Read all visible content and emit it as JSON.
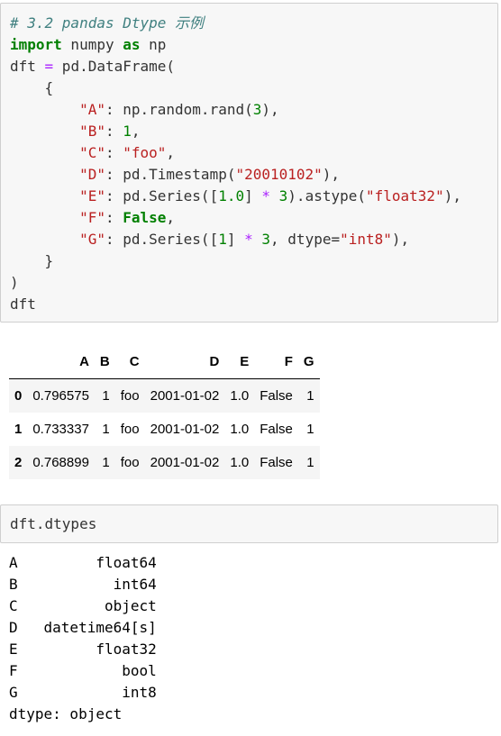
{
  "code_cell_1": {
    "lines": [
      [
        {
          "c": "cm",
          "t": "# 3.2 pandas Dtype 示例"
        }
      ],
      [
        {
          "c": "kw",
          "t": "import"
        },
        {
          "c": "pl",
          "t": " numpy "
        },
        {
          "c": "kw",
          "t": "as"
        },
        {
          "c": "pl",
          "t": " np"
        }
      ],
      [
        {
          "c": "pl",
          "t": "dft "
        },
        {
          "c": "op",
          "t": "="
        },
        {
          "c": "pl",
          "t": " pd.DataFrame("
        }
      ],
      [
        {
          "c": "pl",
          "t": "    {"
        }
      ],
      [
        {
          "c": "pl",
          "t": "        "
        },
        {
          "c": "st",
          "t": "\"A\""
        },
        {
          "c": "pl",
          "t": ": np.random.rand("
        },
        {
          "c": "nm",
          "t": "3"
        },
        {
          "c": "pl",
          "t": "),"
        }
      ],
      [
        {
          "c": "pl",
          "t": "        "
        },
        {
          "c": "st",
          "t": "\"B\""
        },
        {
          "c": "pl",
          "t": ": "
        },
        {
          "c": "nm",
          "t": "1"
        },
        {
          "c": "pl",
          "t": ","
        }
      ],
      [
        {
          "c": "pl",
          "t": "        "
        },
        {
          "c": "st",
          "t": "\"C\""
        },
        {
          "c": "pl",
          "t": ": "
        },
        {
          "c": "st",
          "t": "\"foo\""
        },
        {
          "c": "pl",
          "t": ","
        }
      ],
      [
        {
          "c": "pl",
          "t": "        "
        },
        {
          "c": "st",
          "t": "\"D\""
        },
        {
          "c": "pl",
          "t": ": pd.Timestamp("
        },
        {
          "c": "st",
          "t": "\"20010102\""
        },
        {
          "c": "pl",
          "t": "),"
        }
      ],
      [
        {
          "c": "pl",
          "t": "        "
        },
        {
          "c": "st",
          "t": "\"E\""
        },
        {
          "c": "pl",
          "t": ": pd.Series(["
        },
        {
          "c": "nm",
          "t": "1.0"
        },
        {
          "c": "pl",
          "t": "] "
        },
        {
          "c": "op",
          "t": "*"
        },
        {
          "c": "pl",
          "t": " "
        },
        {
          "c": "nm",
          "t": "3"
        },
        {
          "c": "pl",
          "t": ").astype("
        },
        {
          "c": "st",
          "t": "\"float32\""
        },
        {
          "c": "pl",
          "t": "),"
        }
      ],
      [
        {
          "c": "pl",
          "t": "        "
        },
        {
          "c": "st",
          "t": "\"F\""
        },
        {
          "c": "pl",
          "t": ": "
        },
        {
          "c": "kw",
          "t": "False"
        },
        {
          "c": "pl",
          "t": ","
        }
      ],
      [
        {
          "c": "pl",
          "t": "        "
        },
        {
          "c": "st",
          "t": "\"G\""
        },
        {
          "c": "pl",
          "t": ": pd.Series(["
        },
        {
          "c": "nm",
          "t": "1"
        },
        {
          "c": "pl",
          "t": "] "
        },
        {
          "c": "op",
          "t": "*"
        },
        {
          "c": "pl",
          "t": " "
        },
        {
          "c": "nm",
          "t": "3"
        },
        {
          "c": "pl",
          "t": ", dtype="
        },
        {
          "c": "st",
          "t": "\"int8\""
        },
        {
          "c": "pl",
          "t": "),"
        }
      ],
      [
        {
          "c": "pl",
          "t": "    }"
        }
      ],
      [
        {
          "c": "pl",
          "t": ")"
        }
      ],
      [
        {
          "c": "pl",
          "t": "dft"
        }
      ]
    ]
  },
  "dataframe": {
    "columns": [
      "",
      "A",
      "B",
      "C",
      "D",
      "E",
      "F",
      "G"
    ],
    "rows": [
      [
        "0",
        "0.796575",
        "1",
        "foo",
        "2001-01-02",
        "1.0",
        "False",
        "1"
      ],
      [
        "1",
        "0.733337",
        "1",
        "foo",
        "2001-01-02",
        "1.0",
        "False",
        "1"
      ],
      [
        "2",
        "0.768899",
        "1",
        "foo",
        "2001-01-02",
        "1.0",
        "False",
        "1"
      ]
    ]
  },
  "code_cell_2": {
    "source": "dft.dtypes"
  },
  "dtypes_output": {
    "lines": [
      "A         float64",
      "B           int64",
      "C          object",
      "D   datetime64[s]",
      "E         float32",
      "F            bool",
      "G            int8",
      "dtype: object"
    ]
  }
}
